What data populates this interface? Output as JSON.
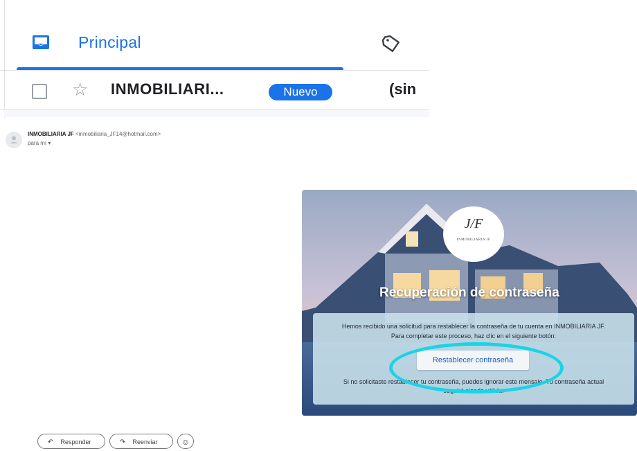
{
  "tabs": {
    "active": {
      "label": "Principal",
      "icon": "inbox-icon"
    },
    "second_icon": "tag-icon",
    "accent": "#1a73e8"
  },
  "list_row": {
    "sender": "INMOBILIARI...",
    "badge": "Nuevo",
    "subject": "(sin"
  },
  "message": {
    "from_name": "INMOBILIARIA JF",
    "from_email": "<inmobiliaria_JF14@hotmail.com>",
    "to": "para mí ▾"
  },
  "email_card": {
    "logo_mark": "J/F",
    "logo_text": "INMOBILIARIA JF",
    "title": "Recuperación de contraseña",
    "body_line1": "Hemos recibido una solicitud para restablecer la contraseña de tu cuenta en INMOBILIARIA JF.",
    "body_line2": "Para completar este proceso, haz clic en el siguiente botón:",
    "button_label": "Restablecer contraseña",
    "footer_line1": "Si no solicitaste restablecer tu contraseña, puedes ignorar este mensaje. Tu contraseña actual",
    "footer_line2": "seguirá siendo válida.",
    "highlight_color": "#19d4e6"
  },
  "actions": {
    "reply": "Responder",
    "forward": "Reenviar",
    "emoji": "☺"
  }
}
